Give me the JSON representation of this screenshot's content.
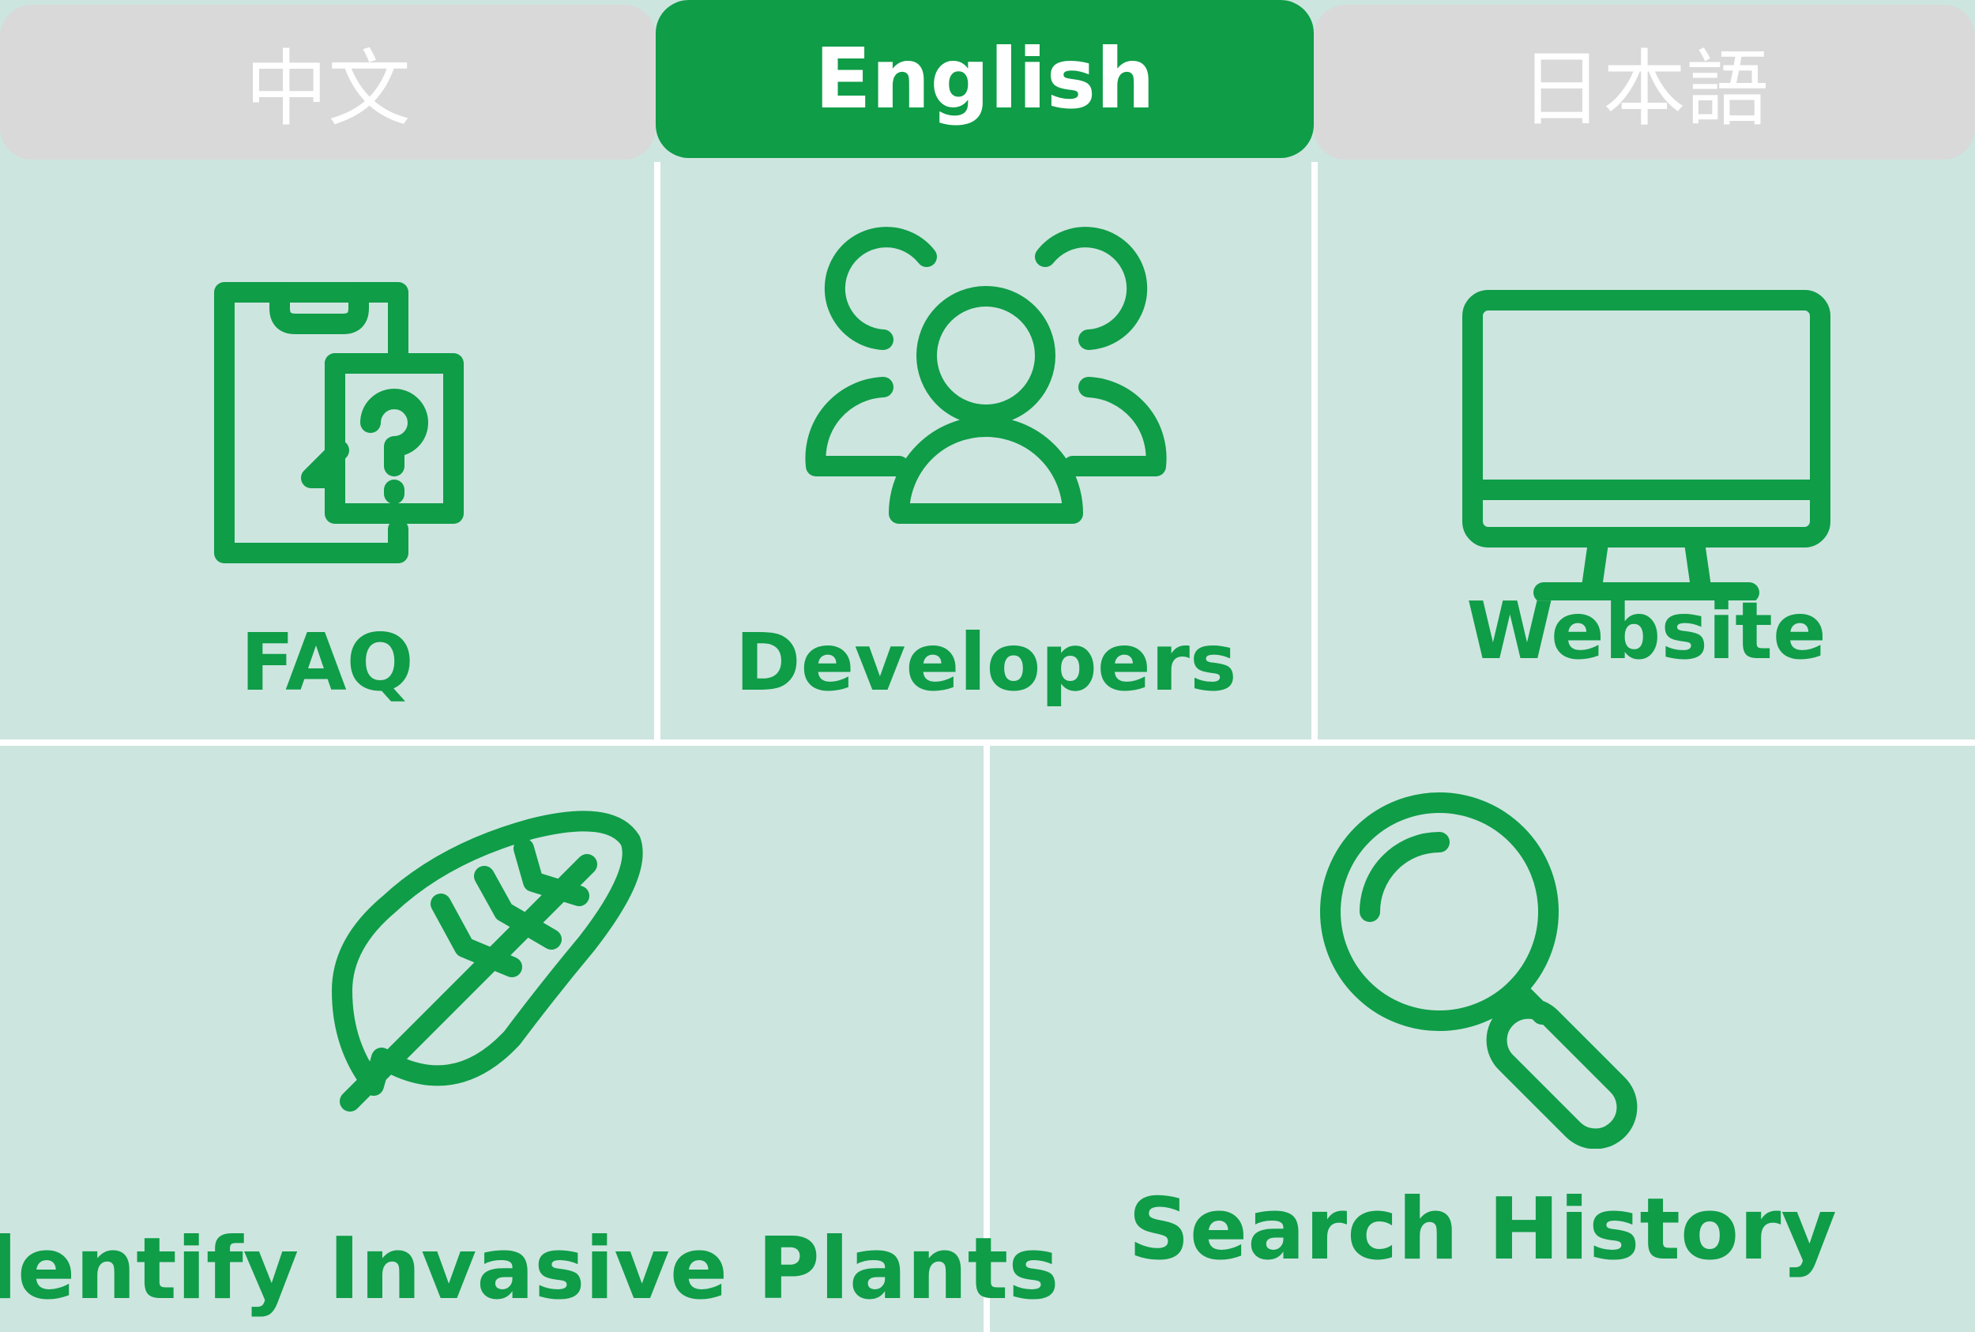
{
  "colors": {
    "accent": "#0F9D48",
    "background": "#CDE5DF",
    "inactive_tab": "#D9D9D9"
  },
  "language_tabs": [
    {
      "label": "中文",
      "active": false
    },
    {
      "label": "English",
      "active": true
    },
    {
      "label": "日本語",
      "active": false
    }
  ],
  "menu": [
    {
      "label": "FAQ",
      "icon": "faq-document-question-icon"
    },
    {
      "label": "Developers",
      "icon": "people-group-icon"
    },
    {
      "label": "Website",
      "icon": "desktop-monitor-icon"
    },
    {
      "label": "Identify Invasive Plants",
      "icon": "leaf-icon"
    },
    {
      "label": "Search History",
      "icon": "magnifier-icon"
    }
  ]
}
